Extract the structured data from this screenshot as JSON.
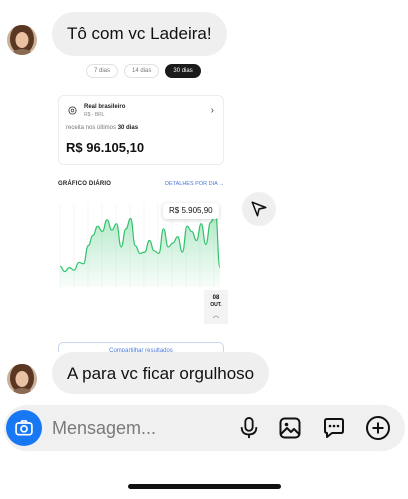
{
  "messages": [
    {
      "text": "Tô com vc Ladeira!"
    },
    {
      "text": "A para vc ficar orgulhoso"
    }
  ],
  "shared_screenshot": {
    "period_chips": [
      "7 dias",
      "14 dias",
      "30 dias"
    ],
    "currency": {
      "name": "Real brasileiro",
      "code": "R$ - BRL",
      "revenue_label_prefix": "receita nos últimos",
      "revenue_label_period": "30 dias",
      "revenue_value": "R$ 96.105,10"
    },
    "chart_title": "GRÁFICO DIÁRIO",
    "chart_link": "DETALHES POR DIA →",
    "tooltip": "R$ 5.905,90",
    "date_day": "08",
    "date_month": "OUT.",
    "share_button": "Compartilhar resultados",
    "chart_data": {
      "type": "area",
      "values": [
        1.6,
        1.2,
        1.5,
        1.3,
        1.9,
        1.8,
        3.2,
        4.0,
        4.7,
        4.3,
        5.2,
        4.4,
        4.9,
        3.1,
        4.5,
        5.3,
        3.2,
        2.6,
        2.7,
        3.6,
        2.8,
        2.6,
        4.5,
        3.1,
        3.4,
        3.9,
        2.7,
        4.7,
        4.3,
        3.6,
        4.9,
        3.3,
        5.0,
        5.9,
        1.5
      ],
      "color": "#2fc26a"
    }
  },
  "composer": {
    "placeholder": "Mensagem..."
  },
  "icons": [
    "avatar",
    "send-post-icon",
    "camera-icon",
    "microphone-icon",
    "gallery-icon",
    "sticker-icon",
    "plus-circle-icon"
  ]
}
